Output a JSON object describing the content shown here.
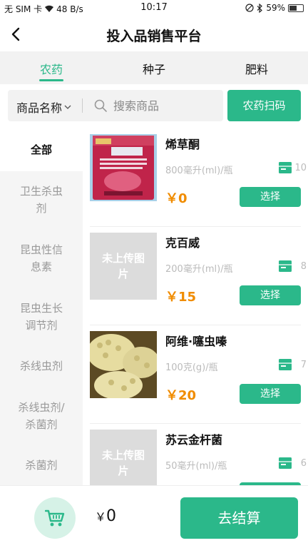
{
  "status_bar": {
    "carrier": "无 SIM 卡",
    "net_speed": "48 B/s",
    "time": "10:17",
    "battery": "59%",
    "battery_level": 0.59
  },
  "header": {
    "title": "投入品销售平台",
    "back_icon": "chevron-left-icon"
  },
  "tabs": [
    {
      "label": "农药",
      "active": true
    },
    {
      "label": "种子",
      "active": false
    },
    {
      "label": "肥料",
      "active": false
    }
  ],
  "search": {
    "filter_label": "商品名称",
    "placeholder": "搜索商品",
    "scan_label": "农药扫码"
  },
  "sidebar": {
    "items": [
      {
        "label": "全部",
        "active": true
      },
      {
        "label": "卫生杀虫剂",
        "active": false
      },
      {
        "label": "昆虫性信息素",
        "active": false
      },
      {
        "label": "昆虫生长调节剂",
        "active": false
      },
      {
        "label": "杀线虫剂",
        "active": false
      },
      {
        "label": "杀线虫剂/杀菌剂",
        "active": false
      },
      {
        "label": "杀菌剂",
        "active": false
      }
    ]
  },
  "products": [
    {
      "name": "烯草酮",
      "spec": "800毫升(ml)/瓶",
      "stock": "10",
      "price": "￥0",
      "select_label": "选择",
      "image": "photo"
    },
    {
      "name": "克百威",
      "spec": "200毫升(ml)/瓶",
      "stock": "8",
      "price": "￥15",
      "select_label": "选择",
      "image": "placeholder",
      "placeholder_text": "未上传图片"
    },
    {
      "name": "阿维·噻虫嗪",
      "spec": "100克(g)/瓶",
      "stock": "7",
      "price": "￥20",
      "select_label": "选择",
      "image": "photo"
    },
    {
      "name": "苏云金杆菌",
      "spec": "50毫升(ml)/瓶",
      "stock": "6",
      "price": "",
      "select_label": "选择",
      "image": "placeholder",
      "placeholder_text": "未上传图片"
    }
  ],
  "cart": {
    "currency": "￥",
    "total": "0",
    "checkout_label": "去结算"
  },
  "colors": {
    "accent": "#2bb88a",
    "price": "#f08c00"
  }
}
